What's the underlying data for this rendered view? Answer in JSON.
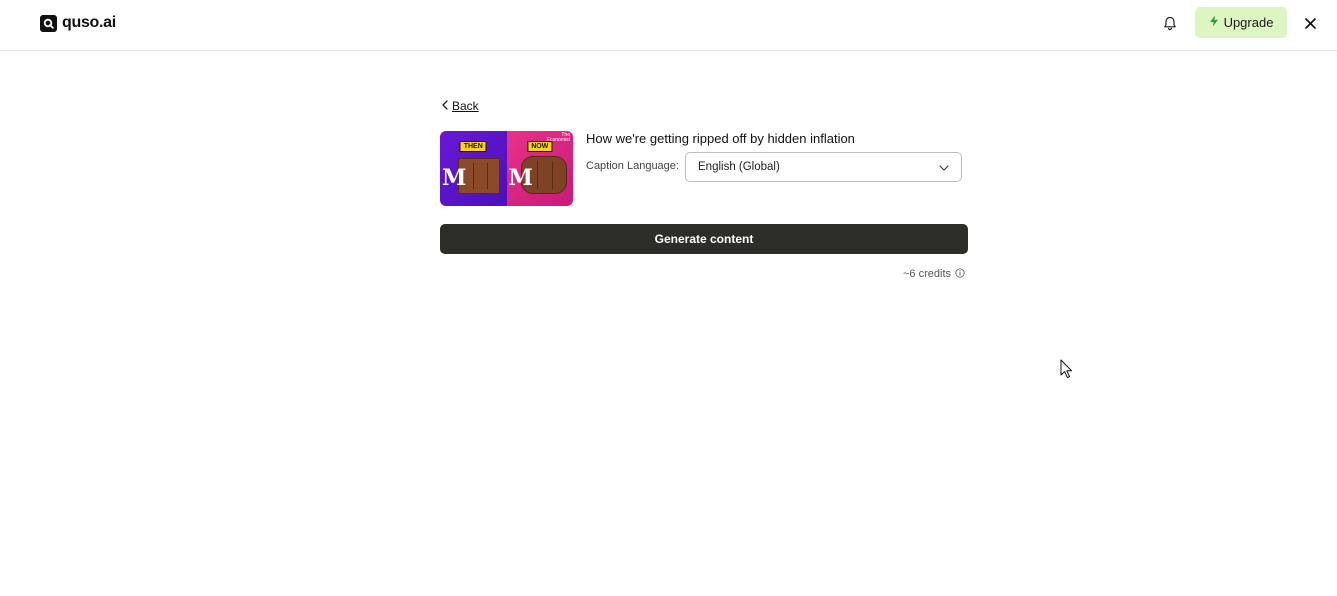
{
  "header": {
    "logo_text": "quso.ai",
    "upgrade_label": "Upgrade",
    "icons": [
      "bell-icon",
      "bolt-icon",
      "close-icon"
    ]
  },
  "back_label": "Back",
  "video": {
    "title": "How we're getting ripped off by hidden inflation",
    "thumbnail": {
      "left_tag": "THEN",
      "right_tag": "NOW",
      "brand_line1": "The",
      "brand_line2": "Economist"
    }
  },
  "caption_language": {
    "label": "Caption Language:",
    "selected": "English (Global)"
  },
  "generate_label": "Generate content",
  "credits_text": "~6 credits",
  "colors": {
    "upgrade_bg": "#dcf5c1",
    "generate_bg": "#2d2d2a"
  }
}
